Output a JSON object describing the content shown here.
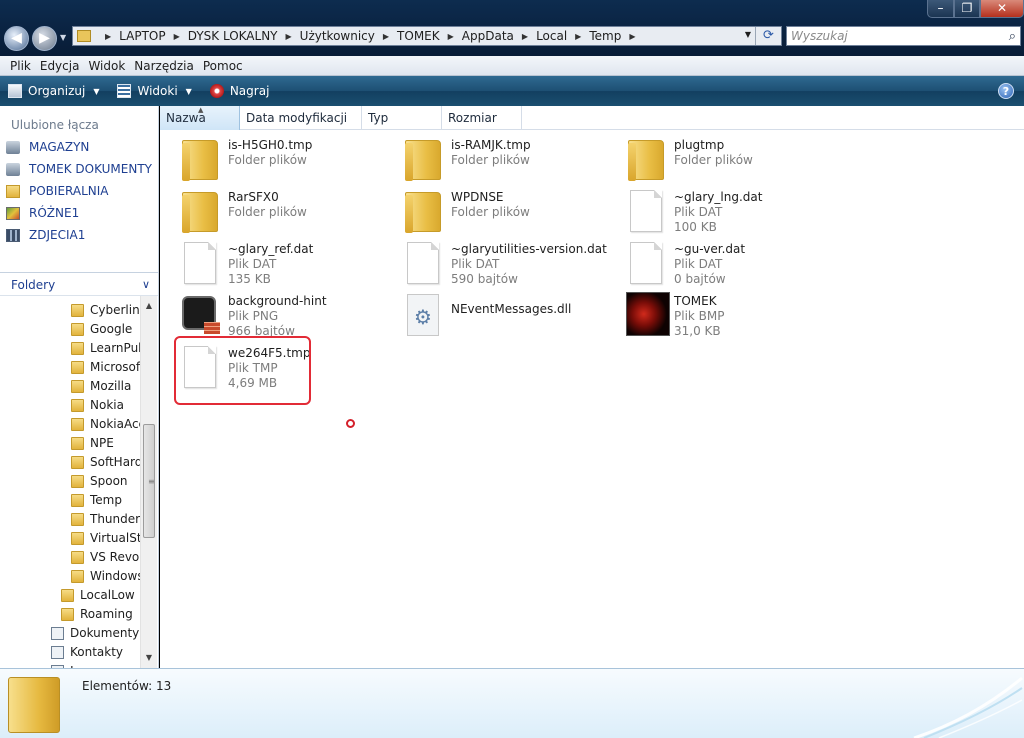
{
  "window_controls": {
    "minimize": "–",
    "maximize": "❐",
    "close": "✕"
  },
  "address_bar": {
    "crumbs": [
      "LAPTOP",
      "DYSK LOKALNY",
      "Użytkownicy",
      "TOMEK",
      "AppData",
      "Local",
      "Temp"
    ]
  },
  "search": {
    "placeholder": "Wyszukaj"
  },
  "menu": [
    "Plik",
    "Edycja",
    "Widok",
    "Narzędzia",
    "Pomoc"
  ],
  "toolbar": {
    "organize": "Organizuj",
    "views": "Widoki",
    "burn": "Nagraj",
    "help": "?"
  },
  "sidebar": {
    "favorites_title": "Ulubione łącza",
    "favorites": [
      "MAGAZYN",
      "TOMEK DOKUMENTY",
      "POBIERALNIA",
      "RÓŻNE1",
      "ZDJECIA1"
    ],
    "folders_title": "Foldery",
    "tree": [
      {
        "label": "Cyberlink",
        "kind": "folder",
        "indent": 2
      },
      {
        "label": "Google",
        "kind": "folder",
        "indent": 2
      },
      {
        "label": "LearnPul",
        "kind": "folder",
        "indent": 2
      },
      {
        "label": "Microsof",
        "kind": "folder",
        "indent": 2
      },
      {
        "label": "Mozilla",
        "kind": "folder",
        "indent": 2
      },
      {
        "label": "Nokia",
        "kind": "folder",
        "indent": 2
      },
      {
        "label": "NokiaAcc",
        "kind": "folder",
        "indent": 2
      },
      {
        "label": "NPE",
        "kind": "folder",
        "indent": 2
      },
      {
        "label": "SoftHard",
        "kind": "folder",
        "indent": 2
      },
      {
        "label": "Spoon",
        "kind": "folder",
        "indent": 2
      },
      {
        "label": "Temp",
        "kind": "folder",
        "indent": 2
      },
      {
        "label": "Thunderb",
        "kind": "folder",
        "indent": 2
      },
      {
        "label": "VirtualSto",
        "kind": "folder",
        "indent": 2
      },
      {
        "label": "VS Revo G",
        "kind": "folder",
        "indent": 2
      },
      {
        "label": "Windows",
        "kind": "folder",
        "indent": 2
      },
      {
        "label": "LocalLow",
        "kind": "folder",
        "indent": 1
      },
      {
        "label": "Roaming",
        "kind": "folder",
        "indent": 1
      },
      {
        "label": "Dokumenty",
        "kind": "doc",
        "indent": 0
      },
      {
        "label": "Kontakty",
        "kind": "doc",
        "indent": 0
      },
      {
        "label": "Łącza",
        "kind": "doc",
        "indent": 0
      }
    ]
  },
  "columns": [
    "Nazwa",
    "Data modyfikacji",
    "Typ",
    "Rozmiar"
  ],
  "files": [
    {
      "name": "is-H5GH0.tmp",
      "type": "Folder plików",
      "size": "",
      "icon": "folder-icon"
    },
    {
      "name": "is-RAMJK.tmp",
      "type": "Folder plików",
      "size": "",
      "icon": "folder-icon"
    },
    {
      "name": "plugtmp",
      "type": "Folder plików",
      "size": "",
      "icon": "folder-icon"
    },
    {
      "name": "RarSFX0",
      "type": "Folder plików",
      "size": "",
      "icon": "folder-icon"
    },
    {
      "name": "WPDNSE",
      "type": "Folder plików",
      "size": "",
      "icon": "folder-icon"
    },
    {
      "name": "~glary_lng.dat",
      "type": "Plik DAT",
      "size": "100 KB",
      "icon": "document-icon"
    },
    {
      "name": "~glary_ref.dat",
      "type": "Plik DAT",
      "size": "135 KB",
      "icon": "document-icon"
    },
    {
      "name": "~glaryutilities-version.dat",
      "type": "Plik DAT",
      "size": "590 bajtów",
      "icon": "document-icon"
    },
    {
      "name": "~gu-ver.dat",
      "type": "Plik DAT",
      "size": "0 bajtów",
      "icon": "document-icon"
    },
    {
      "name": "background-hint",
      "type": "Plik PNG",
      "size": "966 bajtów",
      "icon": "png-image-icon"
    },
    {
      "name": "NEventMessages.dll",
      "type": "",
      "size": "",
      "icon": "dll-gear-icon"
    },
    {
      "name": "TOMEK",
      "type": "Plik BMP",
      "size": "31,0 KB",
      "icon": "bmp-thumbnail-icon"
    },
    {
      "name": "we264F5.tmp",
      "type": "Plik TMP",
      "size": "4,69 MB",
      "icon": "document-icon"
    }
  ],
  "status": {
    "items_count": "Elementów: 13"
  },
  "colors": {
    "highlight": "#e22b36",
    "link": "#1e3f91",
    "command_bar": "#1d4f73"
  }
}
